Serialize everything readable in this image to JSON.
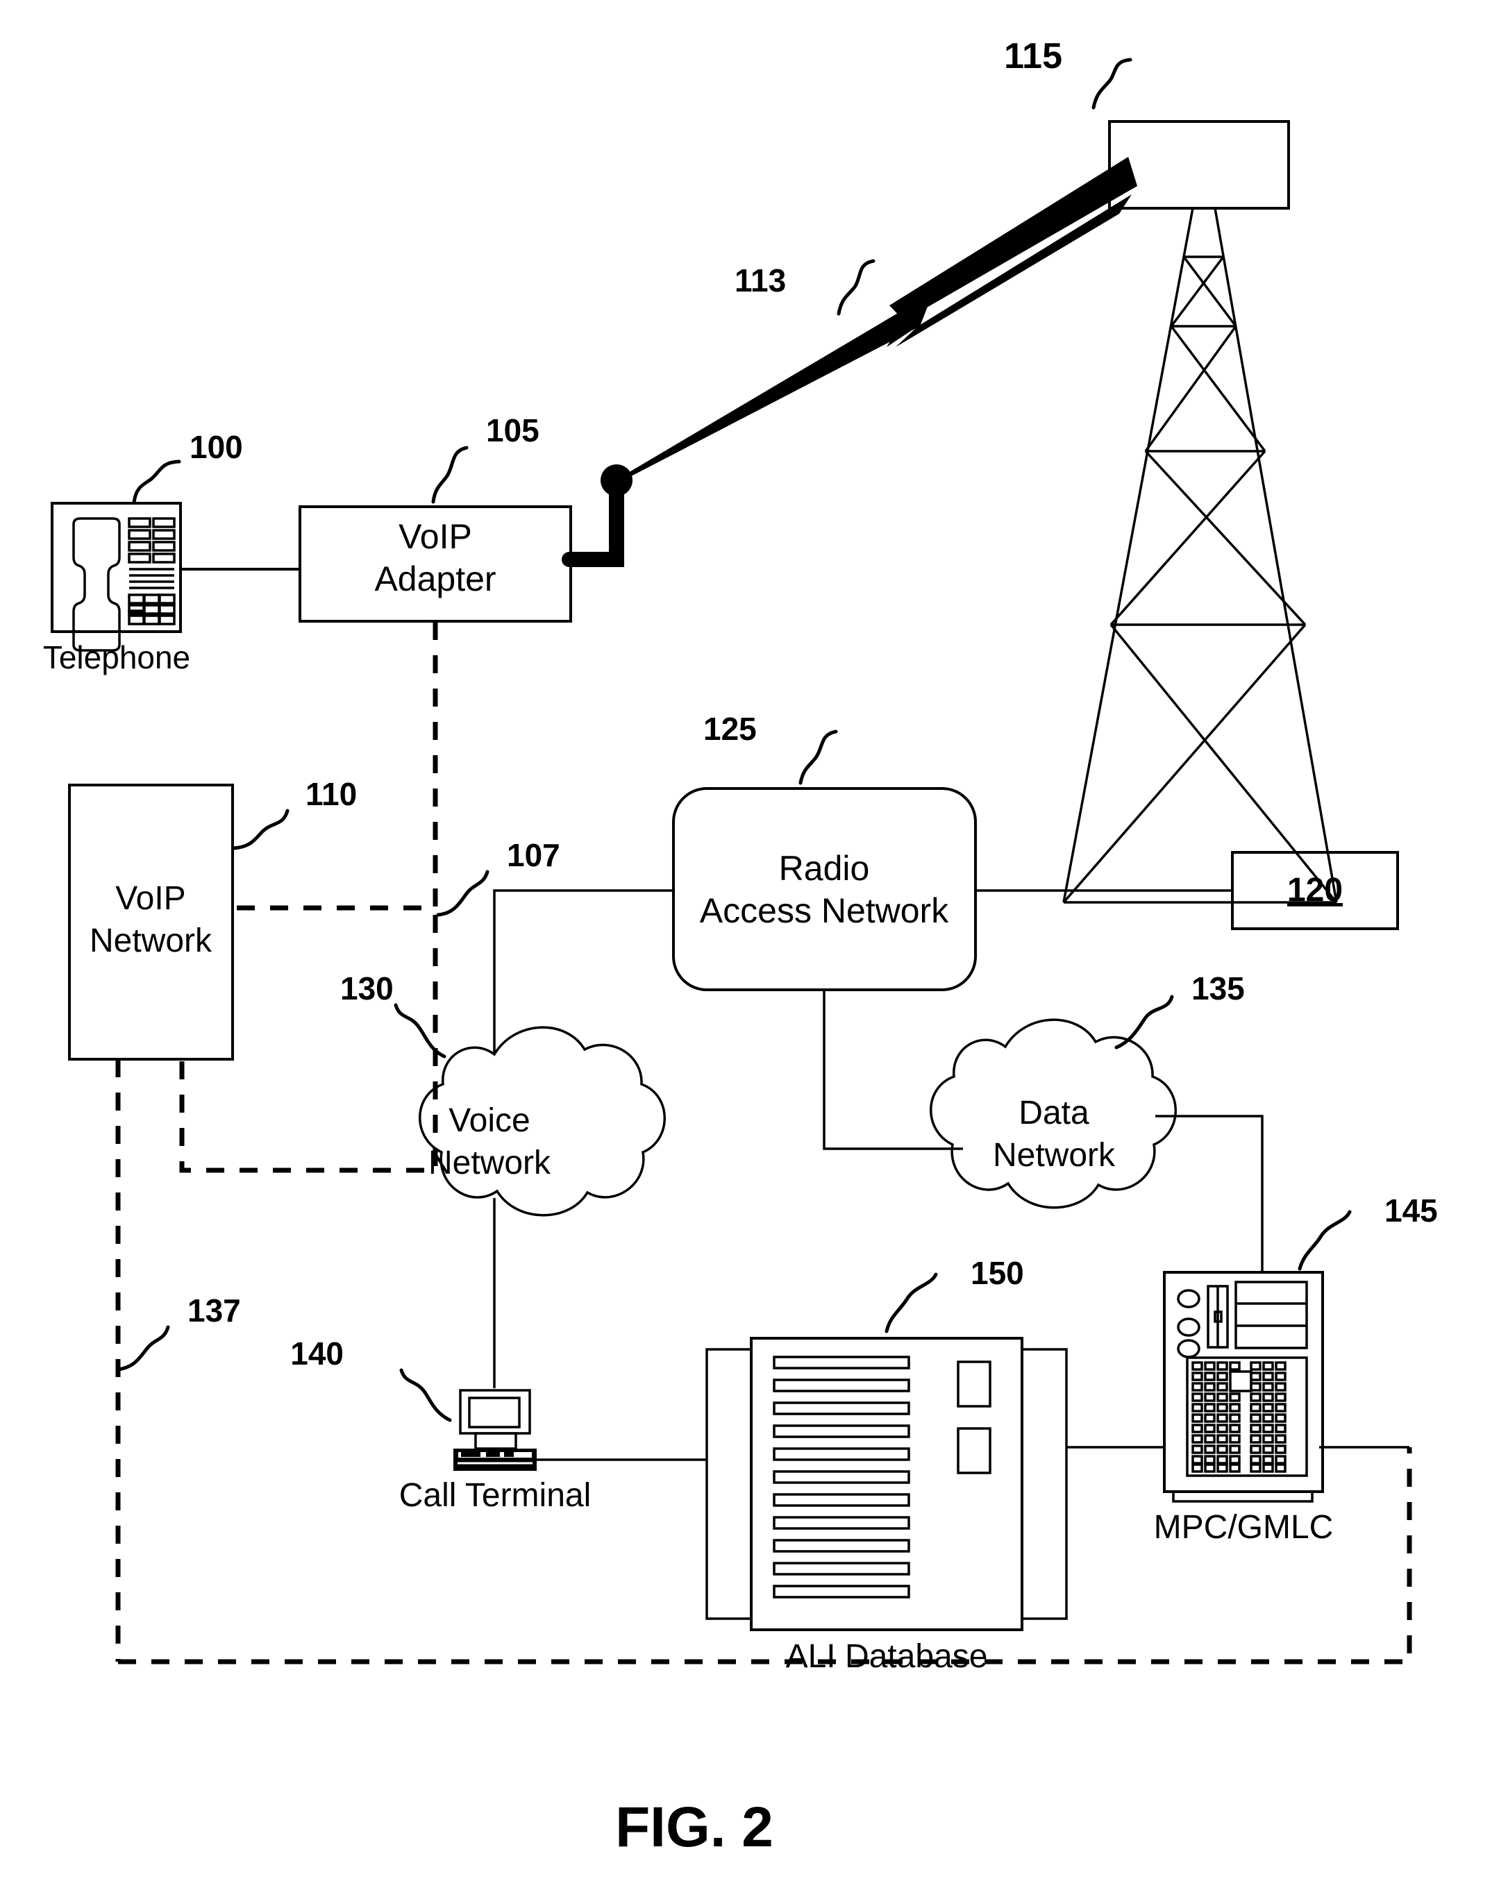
{
  "figure": {
    "caption": "FIG. 2"
  },
  "nodes": {
    "telephone": {
      "ref": "100",
      "caption": "Telephone",
      "icon": "telephone-icon"
    },
    "voip_adapter": {
      "ref": "105",
      "line1": "VoIP",
      "line2": "Adapter"
    },
    "voip_network": {
      "ref": "110",
      "line1": "VoIP",
      "line2": "Network"
    },
    "wireless_link": {
      "ref": "113",
      "icon": "lightning-bolt-icon"
    },
    "base_station": {
      "ref": "115"
    },
    "mobile_unit": {
      "ref": "120",
      "label": "120"
    },
    "radio_access_network": {
      "ref": "125",
      "line1": "Radio",
      "line2": "Access Network"
    },
    "voice_network": {
      "ref": "130",
      "line1": "Voice",
      "line2": "Network"
    },
    "data_network": {
      "ref": "135",
      "line1": "Data",
      "line2": "Network"
    },
    "call_terminal": {
      "ref": "140",
      "caption": "Call Terminal",
      "icon": "desktop-computer-icon"
    },
    "mpc_gmlc": {
      "ref": "145",
      "caption": "MPC/GMLC",
      "icon": "server-tower-icon"
    },
    "ali_database": {
      "ref": "150",
      "caption": "ALI Database",
      "icon": "server-cabinet-icon"
    }
  },
  "connectors": {
    "voip_signalling_path": {
      "ref": "107"
    },
    "location_data_path": {
      "ref": "137"
    }
  }
}
